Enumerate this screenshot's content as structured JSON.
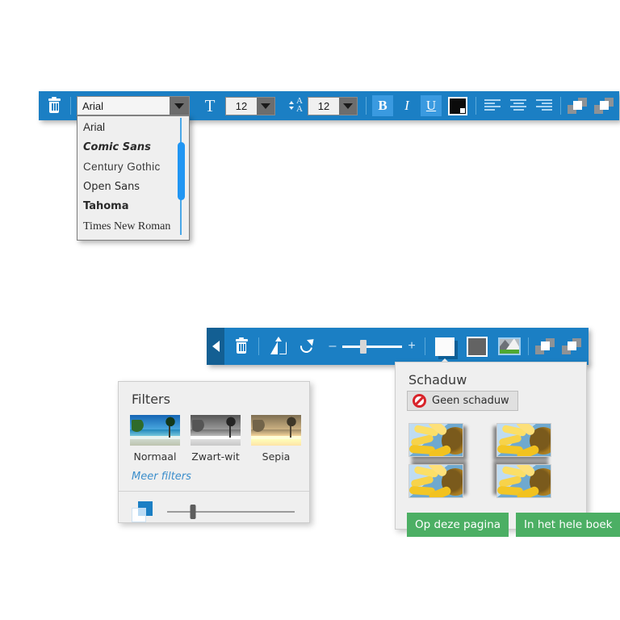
{
  "text_toolbar": {
    "delete_label": "Verwijderen",
    "font_family": {
      "value": "Arial",
      "options": [
        "Arial",
        "Comic Sans",
        "Century Gothic",
        "Open Sans",
        "Tahoma",
        "Times New Roman"
      ]
    },
    "font_size": {
      "value": "12"
    },
    "line_spacing": {
      "value": "12"
    },
    "bold_label": "B",
    "italic_label": "I",
    "underline_label": "U",
    "text_color": "#0b0b0b",
    "align": {
      "left": "Links uitlijnen",
      "center": "Centreren",
      "right": "Rechts uitlijnen"
    },
    "layer": {
      "front": "Naar voren",
      "back": "Naar achteren"
    }
  },
  "image_toolbar": {
    "back_label": "Terug",
    "delete_label": "Verwijderen",
    "flip_label": "Spiegelen",
    "rotate_label": "Draaien",
    "slider": {
      "minus": "–",
      "plus": "+",
      "value": 35
    },
    "mode_shadow_label": "Schaduw",
    "mode_frame_label": "Kader",
    "mode_filters_label": "Filters",
    "layer": {
      "front": "Naar voren",
      "back": "Naar achteren"
    }
  },
  "filters_panel": {
    "title": "Filters",
    "items": [
      {
        "label": "Normaal"
      },
      {
        "label": "Zwart-wit"
      },
      {
        "label": "Sepia"
      }
    ],
    "more_link": "Meer filters",
    "opacity_value": 20
  },
  "shadow_panel": {
    "title": "Schaduw",
    "no_shadow_label": "Geen schaduw",
    "shadow_options": [
      {
        "label": "Schaduw rechtsonder"
      },
      {
        "label": "Schaduw linksonder"
      },
      {
        "label": "Schaduw rechtsboven"
      },
      {
        "label": "Schaduw linksboven"
      }
    ],
    "apply_page": "Op deze pagina",
    "apply_book": "In het hele boek"
  },
  "colors": {
    "toolbar_blue": "#1b7fc4",
    "toolbar_blue_dark": "#135f93",
    "active_blue": "#3a9ae0",
    "scrollbar_blue": "#2196f3",
    "green": "#4caf64",
    "red": "#d8232a",
    "panel_bg": "#efefef"
  }
}
